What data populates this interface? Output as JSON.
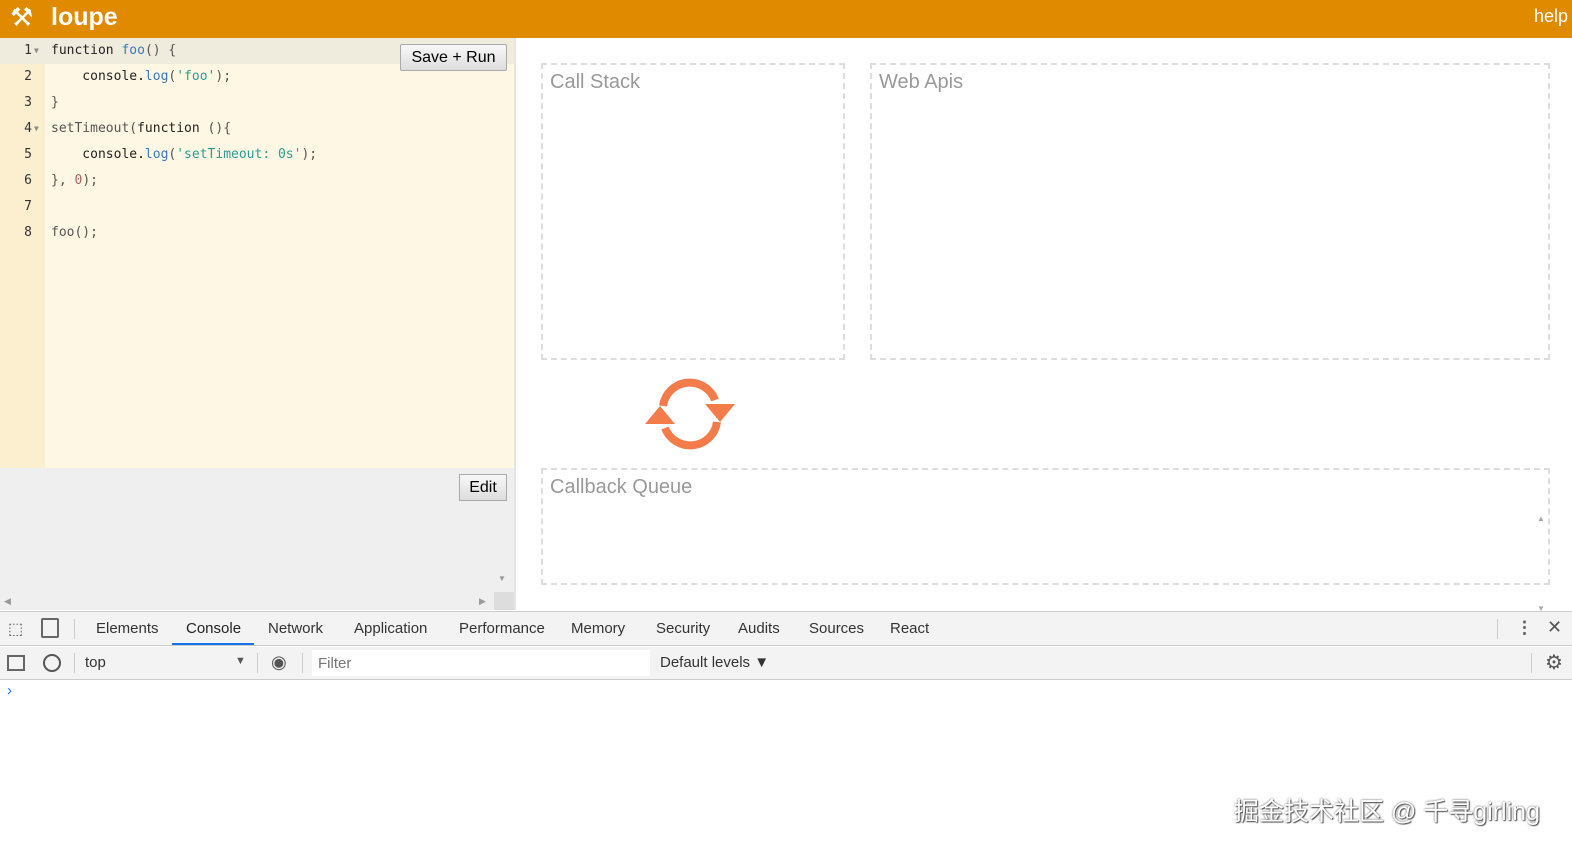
{
  "header": {
    "title": "loupe",
    "help": "help"
  },
  "editor": {
    "save_run": "Save + Run",
    "lines": [
      {
        "n": "1",
        "fold": true,
        "tokens": [
          [
            "kw",
            "function "
          ],
          [
            "fn",
            "foo"
          ],
          [
            "p",
            "() {"
          ]
        ]
      },
      {
        "n": "2",
        "fold": false,
        "tokens": [
          [
            "kw",
            "    console."
          ],
          [
            "fn",
            "log"
          ],
          [
            "p",
            "("
          ],
          [
            "str",
            "'foo'"
          ],
          [
            "p",
            ");"
          ]
        ]
      },
      {
        "n": "3",
        "fold": false,
        "tokens": [
          [
            "p",
            "}"
          ]
        ]
      },
      {
        "n": "4",
        "fold": true,
        "tokens": [
          [
            "p",
            "setTimeout("
          ],
          [
            "kw",
            "function "
          ],
          [
            "p",
            "(){"
          ]
        ]
      },
      {
        "n": "5",
        "fold": false,
        "tokens": [
          [
            "kw",
            "    console."
          ],
          [
            "fn",
            "log"
          ],
          [
            "p",
            "("
          ],
          [
            "str",
            "'setTimeout: 0s'"
          ],
          [
            "p",
            ");"
          ]
        ]
      },
      {
        "n": "6",
        "fold": false,
        "tokens": [
          [
            "p",
            "}, "
          ],
          [
            "num",
            "0"
          ],
          [
            "p",
            ");"
          ]
        ]
      },
      {
        "n": "7",
        "fold": false,
        "tokens": []
      },
      {
        "n": "8",
        "fold": false,
        "tokens": [
          [
            "p",
            "foo();"
          ]
        ]
      }
    ]
  },
  "output": {
    "edit": "Edit"
  },
  "panels": {
    "call_stack": "Call Stack",
    "web_apis": "Web Apis",
    "callback_queue": "Callback Queue"
  },
  "loop_color": "#f47c4a",
  "devtools": {
    "tabs": [
      "Elements",
      "Console",
      "Network",
      "Application",
      "Performance",
      "Memory",
      "Security",
      "Audits",
      "Sources",
      "React"
    ],
    "selected_tab": "Console",
    "context": "top",
    "filter_placeholder": "Filter",
    "levels": "Default levels ▼",
    "prompt": "›"
  },
  "watermark": "掘金技术社区 @ 千寻girling"
}
